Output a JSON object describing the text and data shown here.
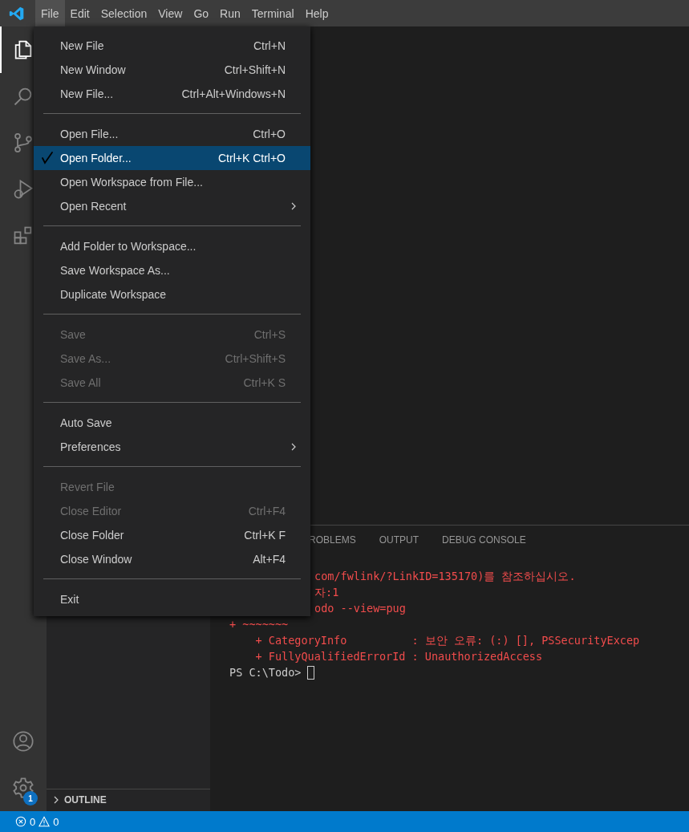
{
  "title_bar": {
    "menus": [
      {
        "label": "File",
        "selected": true
      },
      {
        "label": "Edit",
        "selected": false
      },
      {
        "label": "Selection",
        "selected": false
      },
      {
        "label": "View",
        "selected": false
      },
      {
        "label": "Go",
        "selected": false
      },
      {
        "label": "Run",
        "selected": false
      },
      {
        "label": "Terminal",
        "selected": false
      },
      {
        "label": "Help",
        "selected": false
      }
    ]
  },
  "activity_bar": {
    "settings_badge": "1"
  },
  "sidebar": {
    "sections": [
      {
        "title": "OUTLINE",
        "expanded": false
      }
    ]
  },
  "file_menu": {
    "groups": [
      [
        {
          "label": "New File",
          "shortcut": "Ctrl+N",
          "disabled": false,
          "submenu": false,
          "selected": false,
          "marked": false
        },
        {
          "label": "New Window",
          "shortcut": "Ctrl+Shift+N",
          "disabled": false,
          "submenu": false,
          "selected": false,
          "marked": false
        },
        {
          "label": "New File...",
          "shortcut": "Ctrl+Alt+Windows+N",
          "disabled": false,
          "submenu": false,
          "selected": false,
          "marked": false
        }
      ],
      [
        {
          "label": "Open File...",
          "shortcut": "Ctrl+O",
          "disabled": false,
          "submenu": false,
          "selected": false,
          "marked": false
        },
        {
          "label": "Open Folder...",
          "shortcut": "Ctrl+K Ctrl+O",
          "disabled": false,
          "submenu": false,
          "selected": true,
          "marked": true
        },
        {
          "label": "Open Workspace from File...",
          "disabled": false,
          "submenu": false,
          "selected": false,
          "marked": false
        },
        {
          "label": "Open Recent",
          "disabled": false,
          "submenu": true,
          "selected": false,
          "marked": false
        }
      ],
      [
        {
          "label": "Add Folder to Workspace...",
          "disabled": false,
          "submenu": false,
          "selected": false,
          "marked": false
        },
        {
          "label": "Save Workspace As...",
          "disabled": false,
          "submenu": false,
          "selected": false,
          "marked": false
        },
        {
          "label": "Duplicate Workspace",
          "disabled": false,
          "submenu": false,
          "selected": false,
          "marked": false
        }
      ],
      [
        {
          "label": "Save",
          "shortcut": "Ctrl+S",
          "disabled": true,
          "submenu": false,
          "selected": false,
          "marked": false
        },
        {
          "label": "Save As...",
          "shortcut": "Ctrl+Shift+S",
          "disabled": true,
          "submenu": false,
          "selected": false,
          "marked": false
        },
        {
          "label": "Save All",
          "shortcut": "Ctrl+K S",
          "disabled": true,
          "submenu": false,
          "selected": false,
          "marked": false
        }
      ],
      [
        {
          "label": "Auto Save",
          "disabled": false,
          "submenu": false,
          "selected": false,
          "marked": false
        },
        {
          "label": "Preferences",
          "disabled": false,
          "submenu": true,
          "selected": false,
          "marked": false
        }
      ],
      [
        {
          "label": "Revert File",
          "disabled": true,
          "submenu": false,
          "selected": false,
          "marked": false
        },
        {
          "label": "Close Editor",
          "shortcut": "Ctrl+F4",
          "disabled": true,
          "submenu": false,
          "selected": false,
          "marked": false
        },
        {
          "label": "Close Folder",
          "shortcut": "Ctrl+K F",
          "disabled": false,
          "submenu": false,
          "selected": false,
          "marked": false
        },
        {
          "label": "Close Window",
          "shortcut": "Alt+F4",
          "disabled": false,
          "submenu": false,
          "selected": false,
          "marked": false
        }
      ],
      [
        {
          "label": "Exit",
          "disabled": false,
          "submenu": false,
          "selected": false,
          "marked": false
        }
      ]
    ]
  },
  "panel": {
    "tabs": [
      {
        "label": "ROBLEMS",
        "selected": false
      },
      {
        "label": "OUTPUT",
        "selected": false
      },
      {
        "label": "DEBUG CONSOLE",
        "selected": false
      }
    ],
    "partly_hidden_lines": [
      "com/fwlink/?LinkID=135170)를 참조하십시오.",
      "자:1",
      "odo --view=pug"
    ],
    "terminal_lines": [
      "+ ~~~~~~~",
      "    + CategoryInfo          : 보안 오류: (:) [], PSSecurityExcep",
      "    + FullyQualifiedErrorId : UnauthorizedAccess"
    ],
    "prompt": "PS C:\\Todo>"
  },
  "status_bar": {
    "errors": "0",
    "warnings": "0"
  }
}
